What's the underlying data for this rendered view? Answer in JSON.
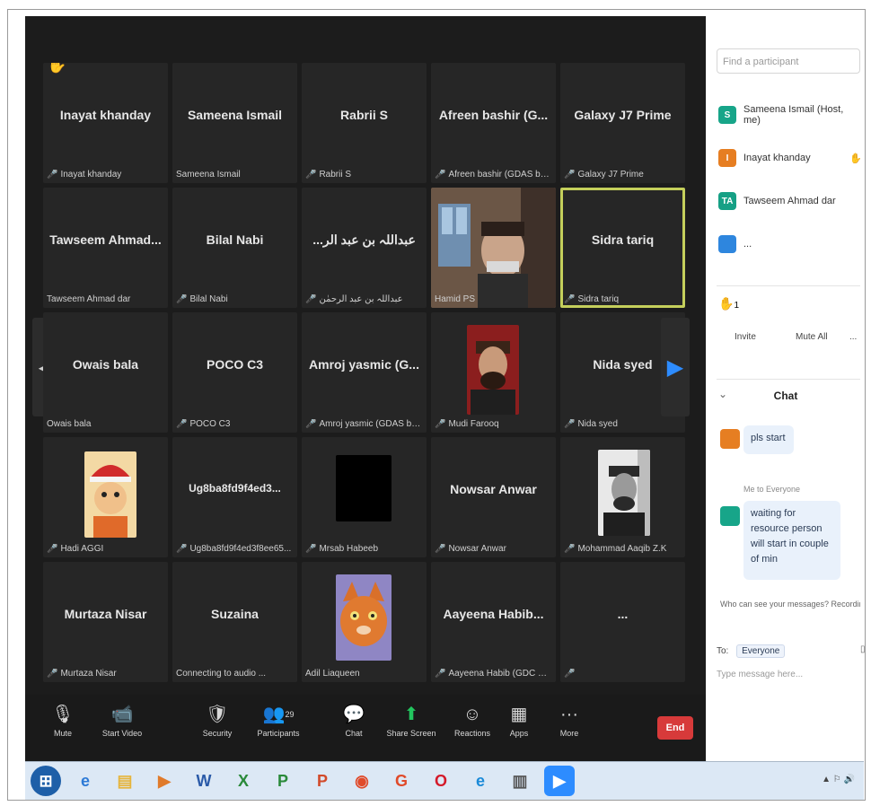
{
  "tiles": [
    {
      "big": "Inayat khanday",
      "small": "Inayat khanday",
      "mic": true
    },
    {
      "big": "Sameena Ismail",
      "small": "Sameena Ismail",
      "mic": false
    },
    {
      "big": "Rabrii S",
      "small": "Rabrii S",
      "mic": true
    },
    {
      "big": "Afreen bashir (G...",
      "small": "Afreen bashir (GDAS berg...",
      "mic": true
    },
    {
      "big": "Galaxy J7 Prime",
      "small": "Galaxy J7 Prime",
      "mic": true
    },
    {
      "big": "Tawseem Ahmad...",
      "small": "Tawseem Ahmad dar",
      "mic": false
    },
    {
      "big": "Bilal Nabi",
      "small": "Bilal Nabi",
      "mic": true
    },
    {
      "big": "...عبداللہ بن عبد الر",
      "small": "عبداللہ بن عبد الرحمٰن",
      "mic": true
    },
    {
      "big": "",
      "small": "Hamid PS",
      "mic": false
    },
    {
      "big": "Sidra tariq",
      "small": "Sidra tariq",
      "mic": true
    },
    {
      "big": "Owais bala",
      "small": "Owais bala",
      "mic": false
    },
    {
      "big": "POCO C3",
      "small": "POCO C3",
      "mic": true
    },
    {
      "big": "Amroj yasmic (G...",
      "small": "Amroj yasmic (GDAS berg...",
      "mic": true
    },
    {
      "big": "",
      "small": "Mudi Farooq",
      "mic": true
    },
    {
      "big": "Nida syed",
      "small": "Nida syed",
      "mic": true
    },
    {
      "big": "",
      "small": "Hadi AGGI",
      "mic": true
    },
    {
      "big": "Ug8ba8fd9f4ed3...",
      "small": "Ug8ba8fd9f4ed3f8ee65...",
      "mic": true
    },
    {
      "big": "",
      "small": "Mrsab Habeeb",
      "mic": true
    },
    {
      "big": "Nowsar Anwar",
      "small": "Nowsar Anwar",
      "mic": true
    },
    {
      "big": "",
      "small": "Mohammad Aaqib Z.K",
      "mic": true
    },
    {
      "big": "Murtaza Nisar",
      "small": "Murtaza Nisar",
      "mic": true
    },
    {
      "big": "Suzaina",
      "small": "Connecting to audio ...",
      "mic": false
    },
    {
      "big": "",
      "small": "Adil Liaqueen",
      "mic": false
    },
    {
      "big": "Aayeena Habib...",
      "small": "Aayeena Habib (GDC Sopo...",
      "mic": true
    },
    {
      "big": "...",
      "small": "",
      "mic": true
    }
  ],
  "toolbar": [
    {
      "label": "Mute",
      "icon": "mic-icon"
    },
    {
      "label": "Start Video",
      "icon": "video-icon"
    },
    {
      "label": "Security",
      "icon": "shield-icon"
    },
    {
      "label": "Participants",
      "icon": "participants-icon",
      "count": "29"
    },
    {
      "label": "Chat",
      "icon": "chat-icon"
    },
    {
      "label": "Share Screen",
      "icon": "share-screen-icon"
    },
    {
      "label": "Reactions",
      "icon": "reactions-icon"
    },
    {
      "label": "Apps",
      "icon": "apps-icon"
    },
    {
      "label": "More",
      "icon": "more-icon"
    }
  ],
  "end_label": "End",
  "sidebar": {
    "find_placeholder": "Find a participant",
    "participants": [
      {
        "initial": "S",
        "name": "Sameena Ismail (Host, me)",
        "color": "#17a589"
      },
      {
        "initial": "I",
        "name": "Inayat khanday",
        "color": "#e67e22"
      },
      {
        "initial": "TA",
        "name": "Tawseem Ahmad dar",
        "color": "#16a085"
      },
      {
        "initial": "",
        "name": "...",
        "color": "#2e86de"
      }
    ],
    "emoji_count": "1",
    "reactions": [
      "Invite",
      "Mute All",
      "..."
    ],
    "chat_title": "Chat",
    "messages": [
      {
        "initial": "",
        "text": "pls start",
        "color": "#e67e22"
      },
      {
        "from": "Me to Everyone",
        "initial": "",
        "text": "waiting for resource person will start in couple of min",
        "color": "#17a589"
      }
    ],
    "notice": "Who can see your messages? Recording on",
    "to_label": "To:",
    "to_value": "Everyone",
    "type_placeholder": "Type message here..."
  },
  "colors": {
    "meeting_bg": "#1c1c1c",
    "tile_bg": "#262626",
    "active_border": "#c4cf5b",
    "end_button": "#d73a3a",
    "share_green": "#22c55e",
    "nav_arrow_blue": "#2d8cff"
  }
}
